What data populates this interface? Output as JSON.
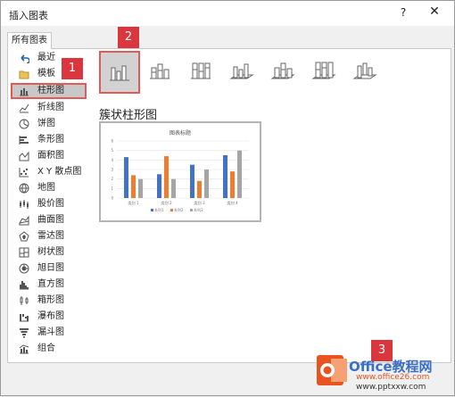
{
  "dialog": {
    "title": "插入图表",
    "help_label": "?",
    "close_label": "✕"
  },
  "tab": {
    "label": "所有图表"
  },
  "nav": {
    "items": [
      {
        "label": "最近",
        "icon": "undo-icon"
      },
      {
        "label": "模板",
        "icon": "folder-icon"
      },
      {
        "label": "柱形图",
        "icon": "column-chart-icon"
      },
      {
        "label": "折线图",
        "icon": "line-chart-icon"
      },
      {
        "label": "饼图",
        "icon": "pie-chart-icon"
      },
      {
        "label": "条形图",
        "icon": "bar-chart-icon"
      },
      {
        "label": "面积图",
        "icon": "area-chart-icon"
      },
      {
        "label": "X Y 散点图",
        "icon": "scatter-chart-icon"
      },
      {
        "label": "地图",
        "icon": "map-chart-icon"
      },
      {
        "label": "股价图",
        "icon": "stock-chart-icon"
      },
      {
        "label": "曲面图",
        "icon": "surface-chart-icon"
      },
      {
        "label": "雷达图",
        "icon": "radar-chart-icon"
      },
      {
        "label": "树状图",
        "icon": "treemap-chart-icon"
      },
      {
        "label": "旭日图",
        "icon": "sunburst-chart-icon"
      },
      {
        "label": "直方图",
        "icon": "histogram-chart-icon"
      },
      {
        "label": "箱形图",
        "icon": "box-whisker-chart-icon"
      },
      {
        "label": "瀑布图",
        "icon": "waterfall-chart-icon"
      },
      {
        "label": "漏斗图",
        "icon": "funnel-chart-icon"
      },
      {
        "label": "组合",
        "icon": "combo-chart-icon"
      }
    ],
    "selected_index": 2
  },
  "subtypes": {
    "selected_label": "簇状柱形图"
  },
  "badges": {
    "b1": "1",
    "b2": "2",
    "b3": "3"
  },
  "preview": {
    "title": "图表标题"
  },
  "chart_data": {
    "type": "bar",
    "title": "图表标题",
    "categories": [
      "类别 1",
      "类别 2",
      "类别 3",
      "类别 4"
    ],
    "series": [
      {
        "name": "系列1",
        "values": [
          4.3,
          2.5,
          3.5,
          4.5
        ]
      },
      {
        "name": "系列2",
        "values": [
          2.4,
          4.4,
          1.8,
          2.8
        ]
      },
      {
        "name": "系列3",
        "values": [
          2,
          2,
          3,
          5
        ]
      }
    ],
    "ylim": [
      0,
      6
    ],
    "yticks": [
      "0",
      "1",
      "2",
      "3",
      "4",
      "5",
      "6"
    ],
    "grid": true,
    "legend": "bottom",
    "colors": [
      "#4472c4",
      "#ed7d31",
      "#a5a5a5"
    ]
  },
  "watermark": {
    "brand": "Office教程网",
    "url1": "www.office26.com",
    "url2": "www.pptxxw.com"
  },
  "colors": {
    "accent_red": "#d9363e",
    "selection_border": "#e05a5a",
    "office_orange": "#e8531f"
  }
}
